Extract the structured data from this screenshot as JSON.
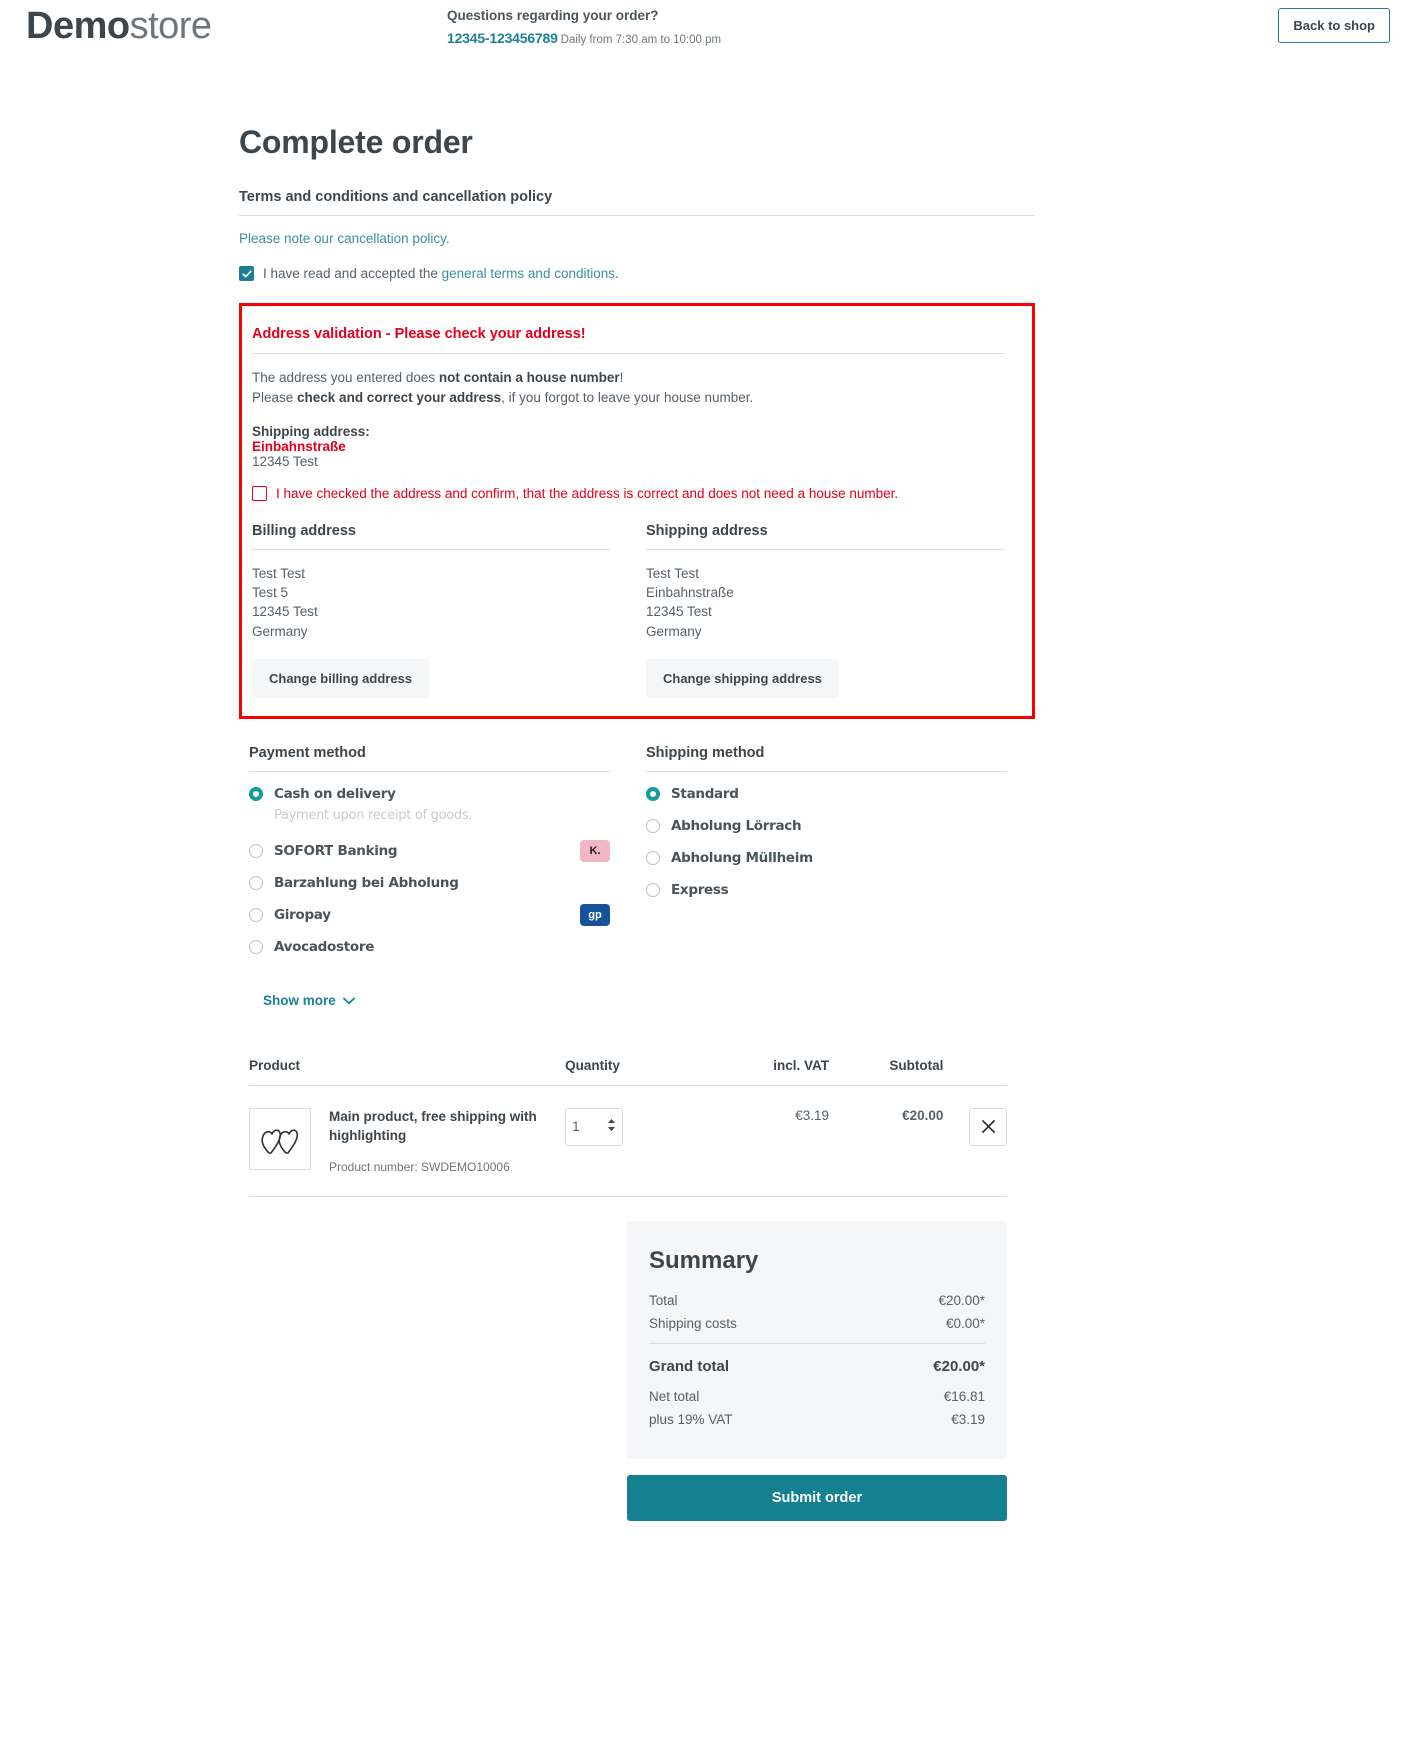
{
  "header": {
    "logo_bold": "Demo",
    "logo_light": "store",
    "contact_title": "Questions regarding your order?",
    "phone": "12345-123456789",
    "hours": "Daily from 7:30 am to 10:00 pm",
    "back_to_shop": "Back to shop"
  },
  "page": {
    "title": "Complete order"
  },
  "terms": {
    "heading": "Terms and conditions and cancellation policy",
    "cancellation_link": "Please note our cancellation policy.",
    "accept_prefix": "I have read and accepted the ",
    "accept_link": "general terms and conditions",
    "accept_suffix": ".",
    "accepted": true
  },
  "validation": {
    "title": "Address validation - Please check your address!",
    "line1_pre": "The address you entered does ",
    "line1_bold": "not contain a house number",
    "line1_post": "!",
    "line2_pre": "Please ",
    "line2_bold": "check and correct your address",
    "line2_post": ", if you forgot to leave your house number.",
    "shipping_label": "Shipping address:",
    "street": "Einbahnstraße",
    "city": "12345 Test",
    "confirm_label": "I have checked the address and confirm, that the address is correct and does not need a house number.",
    "confirm_checked": false,
    "border_color": "#fb0000",
    "text_color": "#e2001a"
  },
  "addresses": {
    "billing": {
      "heading": "Billing address",
      "lines": [
        "Test Test",
        "Test 5",
        "12345 Test",
        "Germany"
      ],
      "button": "Change billing address"
    },
    "shipping": {
      "heading": "Shipping address",
      "lines": [
        "Test Test",
        "Einbahnstraße",
        "12345 Test",
        "Germany"
      ],
      "button": "Change shipping address"
    }
  },
  "payment": {
    "heading": "Payment method",
    "options": [
      {
        "label": "Cash on delivery",
        "selected": true,
        "description": "Payment upon receipt of goods.",
        "icon": ""
      },
      {
        "label": "SOFORT Banking",
        "selected": false,
        "description": "",
        "icon": "klarna-icon",
        "icon_text": "K."
      },
      {
        "label": "Barzahlung bei Abholung",
        "selected": false,
        "description": "",
        "icon": ""
      },
      {
        "label": "Giropay",
        "selected": false,
        "description": "",
        "icon": "giropay-icon",
        "icon_text": "gp"
      },
      {
        "label": "Avocadostore",
        "selected": false,
        "description": "",
        "icon": ""
      }
    ],
    "show_more": "Show more"
  },
  "shipping_method": {
    "heading": "Shipping method",
    "options": [
      {
        "label": "Standard",
        "selected": true
      },
      {
        "label": "Abholung Lörrach",
        "selected": false
      },
      {
        "label": "Abholung Müllheim",
        "selected": false
      },
      {
        "label": "Express",
        "selected": false
      }
    ]
  },
  "cart": {
    "columns": [
      "Product",
      "Quantity",
      "incl. VAT",
      "Subtotal"
    ],
    "rows": [
      {
        "name": "Main product, free shipping with highlighting",
        "product_number_label": "Product number: SWDEMO10006",
        "quantity": "1",
        "vat": "€3.19",
        "subtotal": "€20.00"
      }
    ]
  },
  "summary": {
    "title": "Summary",
    "rows": [
      {
        "label": "Total",
        "value": "€20.00*"
      },
      {
        "label": "Shipping costs",
        "value": "€0.00*"
      }
    ],
    "grand_total_label": "Grand total",
    "grand_total_value": "€20.00*",
    "after_rows": [
      {
        "label": "Net total",
        "value": "€16.81"
      },
      {
        "label": "plus 19% VAT",
        "value": "€3.19"
      }
    ],
    "submit_label": "Submit order",
    "accent_color": "#15808f"
  }
}
